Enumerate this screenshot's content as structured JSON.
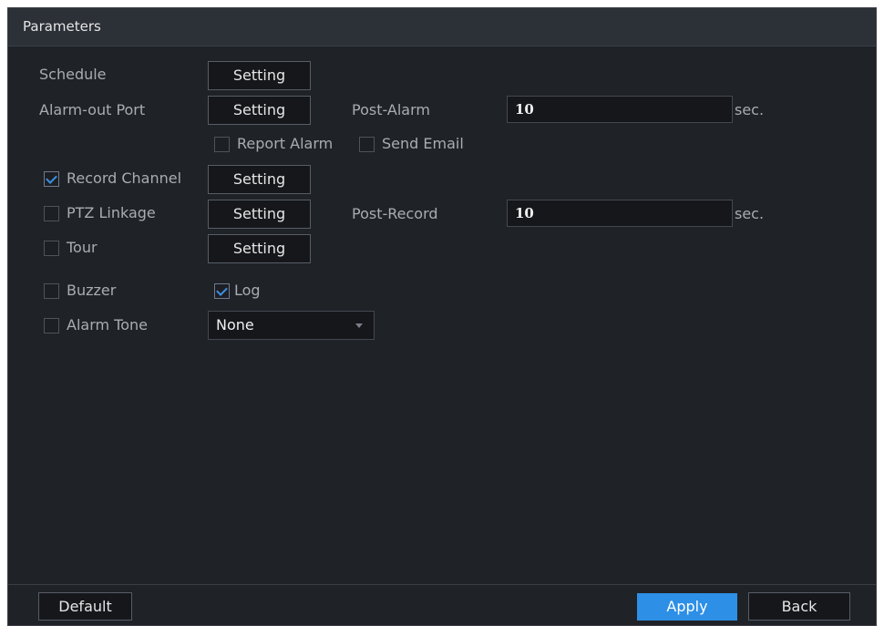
{
  "title": "Parameters",
  "rows": {
    "schedule": {
      "label": "Schedule",
      "button": "Setting"
    },
    "alarm_out": {
      "label": "Alarm-out Port",
      "button": "Setting",
      "post_label": "Post-Alarm",
      "post_value": "10",
      "unit": "sec."
    },
    "report_alarm": {
      "label": "Report Alarm",
      "checked": false
    },
    "send_email": {
      "label": "Send Email",
      "checked": false
    },
    "record_channel": {
      "label": "Record Channel",
      "checked": true,
      "button": "Setting"
    },
    "ptz_linkage": {
      "label": "PTZ Linkage",
      "checked": false,
      "button": "Setting",
      "post_label": "Post-Record",
      "post_value": "10",
      "unit": "sec."
    },
    "tour": {
      "label": "Tour",
      "checked": false,
      "button": "Setting"
    },
    "buzzer": {
      "label": "Buzzer",
      "checked": false
    },
    "log": {
      "label": "Log",
      "checked": true
    },
    "alarm_tone": {
      "label": "Alarm Tone",
      "checked": false,
      "selected": "None"
    }
  },
  "footer": {
    "default": "Default",
    "apply": "Apply",
    "back": "Back"
  },
  "colors": {
    "accent": "#2e8fe6",
    "background": "#1f2227",
    "titlebar": "#2c3037"
  }
}
